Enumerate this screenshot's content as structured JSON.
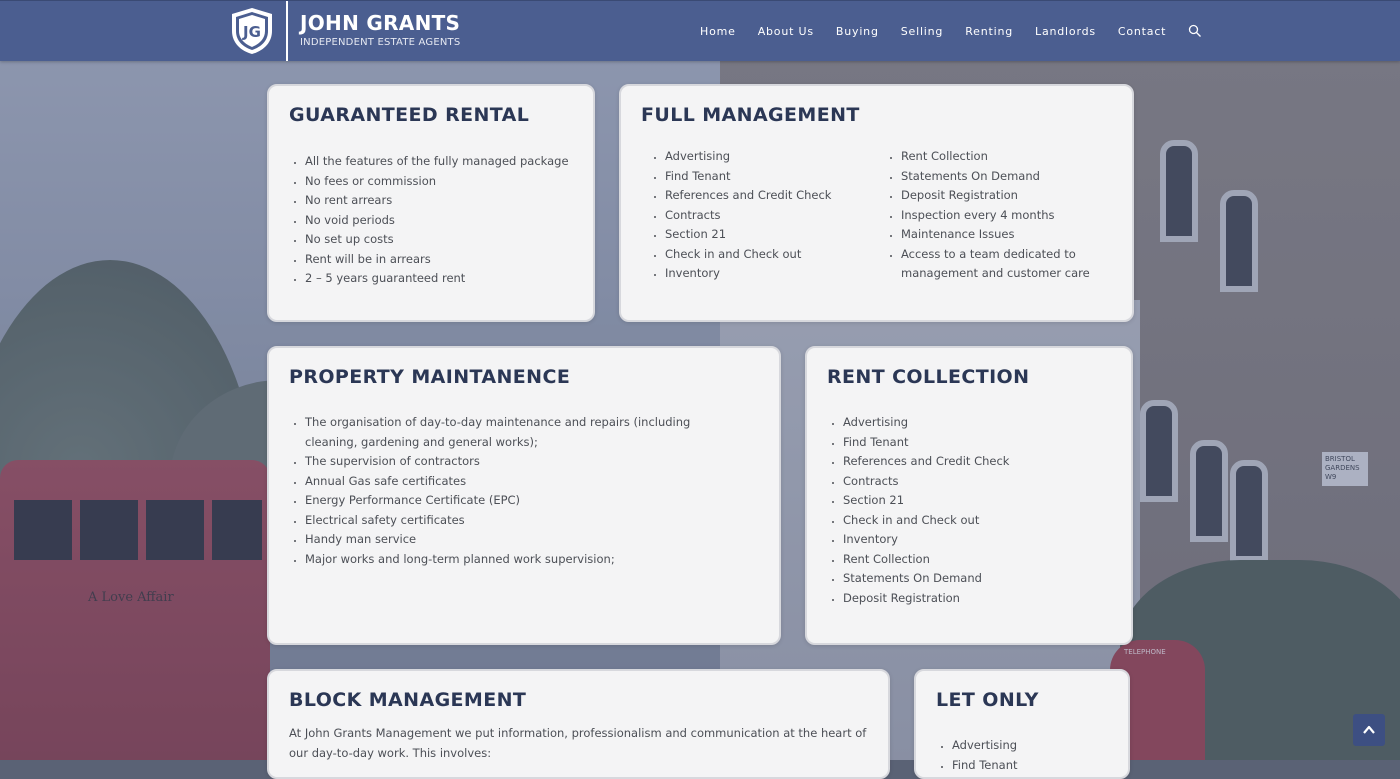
{
  "brand": {
    "logo_initials": "JG",
    "name": "JOHN GRANTS",
    "tagline": "INDEPENDENT ESTATE AGENTS"
  },
  "nav": {
    "items": [
      "Home",
      "About Us",
      "Buying",
      "Selling",
      "Renting",
      "Landlords",
      "Contact"
    ],
    "search_icon": "search-icon"
  },
  "cards": {
    "guaranteed_rental": {
      "title": "GUARANTEED RENTAL",
      "items": [
        "All the features of the fully managed package",
        "No fees or commission",
        "No rent arrears",
        "No void periods",
        "No set up costs",
        "Rent will be in arrears",
        "2 – 5 years guaranteed rent"
      ]
    },
    "full_management": {
      "title": "FULL MANAGEMENT",
      "items_left": [
        "Advertising",
        "Find Tenant",
        "References and Credit Check",
        "Contracts",
        "Section 21",
        "Check in and Check out",
        "Inventory"
      ],
      "items_right": [
        "Rent Collection",
        "Statements On Demand",
        "Deposit Registration",
        "Inspection every 4 months",
        "Maintenance Issues",
        "Access to a team dedicated to management and customer care"
      ]
    },
    "property_maintenance": {
      "title": "PROPERTY MAINTANENCE",
      "items": [
        "The organisation of day-to-day maintenance and repairs (including cleaning, gardening and general works);",
        "The supervision of contractors",
        "Annual Gas safe certificates",
        "Energy Performance Certificate (EPC)",
        "Electrical safety certificates",
        "Handy man service",
        "Major works and long-term planned work supervision;"
      ]
    },
    "rent_collection": {
      "title": "RENT COLLECTION",
      "items": [
        "Advertising",
        "Find Tenant",
        "References and Credit Check",
        "Contracts",
        "Section 21",
        "Check in and Check out",
        "Inventory",
        "Rent Collection",
        "Statements On Demand",
        "Deposit Registration"
      ]
    },
    "block_management": {
      "title": "BLOCK MANAGEMENT",
      "intro": "At John Grants Management we put information, professionalism and communication at the heart of our day-to-day work. This involves:"
    },
    "let_only": {
      "title": "LET ONLY",
      "items": [
        "Advertising",
        "Find Tenant"
      ]
    }
  },
  "background": {
    "bus_ad_text": "A Love Affair",
    "street_sign": "BRISTOL GARDENS W9",
    "booth_sign": "TELEPHONE"
  },
  "back_to_top_icon": "chevron-up-icon",
  "colors": {
    "header": "#4b5e90",
    "heading": "#2b3755",
    "card_bg": "#f4f4f5",
    "text": "#4c4f56"
  }
}
